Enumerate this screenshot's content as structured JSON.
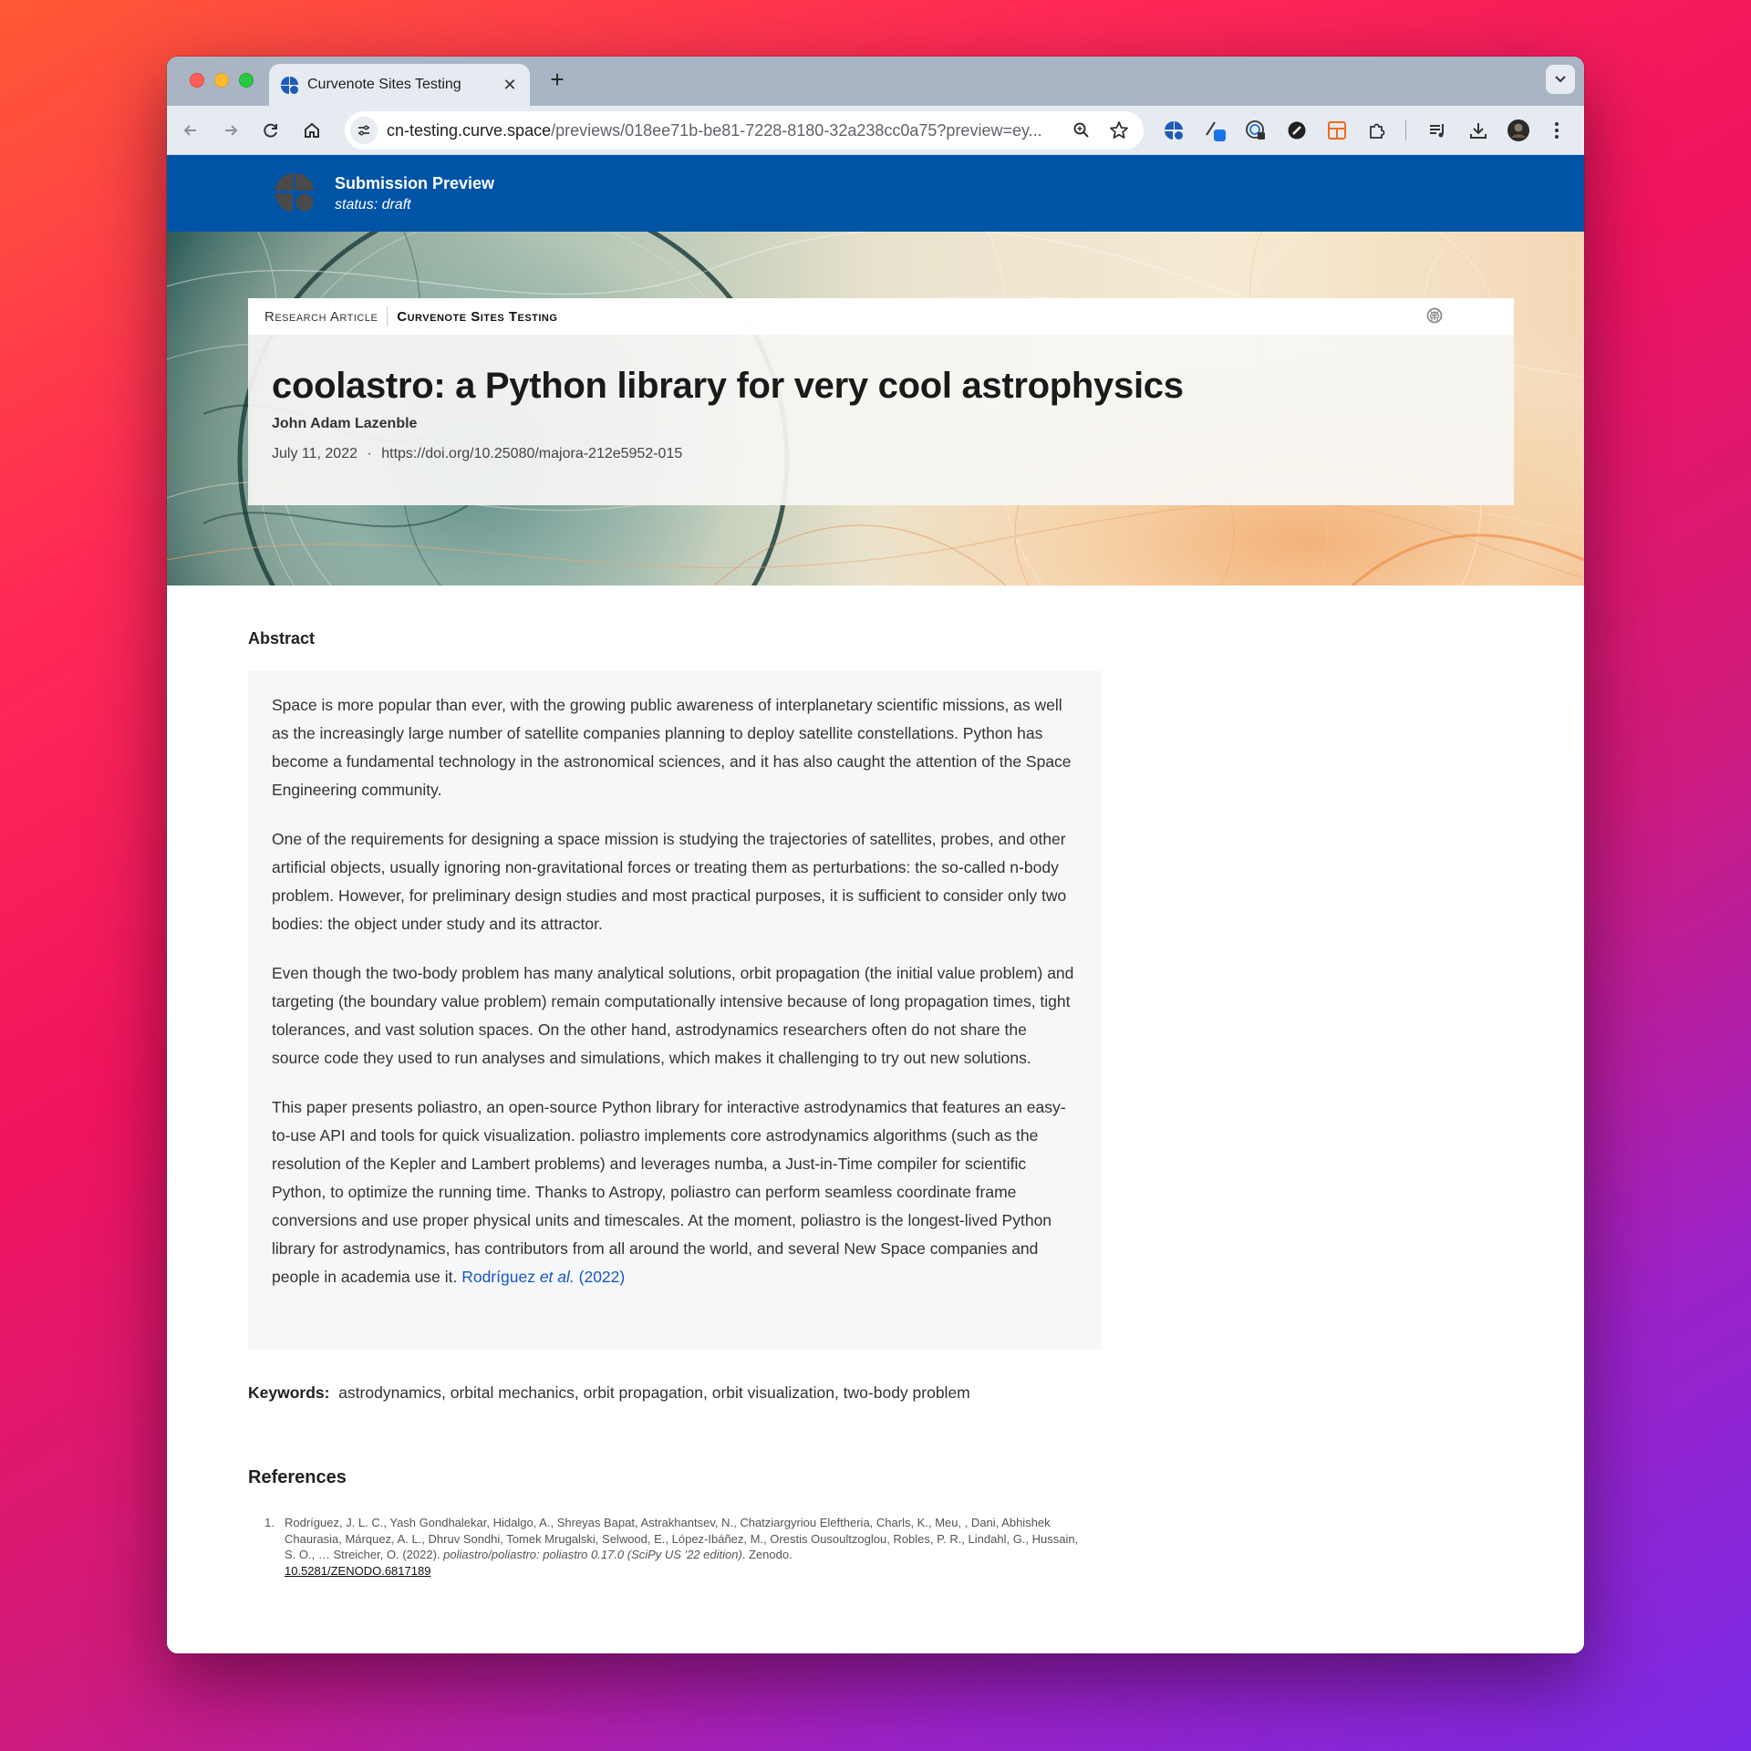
{
  "browser": {
    "tab_title": "Curvenote Sites Testing",
    "url_host": "cn-testing.curve.space",
    "url_path": "/previews/018ee71b-be81-7228-8180-32a238cc0a75?preview=ey..."
  },
  "banner": {
    "title": "Submission Preview",
    "status": "status: draft"
  },
  "article": {
    "kicker": "Research Article",
    "venue": "Curvenote Sites Testing",
    "title": "coolastro: a Python library for very cool astrophysics",
    "author": "John Adam Lazenble",
    "date": "July 11, 2022",
    "doi": "https://doi.org/10.25080/majora-212e5952-015"
  },
  "abstract": {
    "heading": "Abstract",
    "paragraphs": [
      "Space is more popular than ever, with the growing public awareness of interplanetary scientific missions, as well as the increasingly large number of satellite companies planning to deploy satellite constellations. Python has become a fundamental technology in the astronomical sciences, and it has also caught the attention of the Space Engineering community.",
      "One of the requirements for designing a space mission is studying the trajectories of satellites, probes, and other artificial objects, usually ignoring non-gravitational forces or treating them as perturbations: the so-called n-body problem. However, for preliminary design studies and most practical purposes, it is sufficient to consider only two bodies: the object under study and its attractor.",
      "Even though the two-body problem has many analytical solutions, orbit propagation (the initial value problem) and targeting (the boundary value problem) remain computationally intensive because of long propagation times, tight tolerances, and vast solution spaces. On the other hand, astrodynamics researchers often do not share the source code they used to run analyses and simulations, which makes it challenging to try out new solutions.",
      "This paper presents poliastro, an open-source Python library for interactive astrodynamics that features an easy-to-use API and tools for quick visualization. poliastro implements core astrodynamics algorithms (such as the resolution of the Kepler and Lambert problems) and leverages numba, a Just-in-Time compiler for scientific Python, to optimize the running time. Thanks to Astropy, poliastro can perform seamless coordinate frame conversions and use proper physical units and timescales. At the moment, poliastro is the longest-lived Python library for astrodynamics, has contributors from all around the world, and several New Space companies and people in academia use it."
    ],
    "cite_author": "Rodríguez ",
    "cite_etal": "et al.",
    "cite_year": " (2022)"
  },
  "keywords": {
    "label": "Keywords:",
    "values": "astrodynamics, orbital mechanics, orbit propagation, orbit visualization, two-body problem"
  },
  "references": {
    "heading": "References",
    "items": [
      {
        "num": "1.",
        "authors": "Rodríguez, J. L. C., Yash Gondhalekar, Hidalgo, A., Shreyas Bapat, Astrakhantsev, N., Chatziargyriou Eleftheria, Charls, K., Meu, , Dani, Abhishek Chaurasia, Márquez, A. L., Dhruv Sondhi, Tomek Mrugalski, Selwood, E., López-Ibáñez, M., Orestis Ousoultzoglou, Robles, P. R., Lindahl, G., Hussain, S. O., … Streicher, O. (2022). ",
        "title": "poliastro/poliastro: poliastro 0.17.0 (SciPy US '22 edition)",
        "publisher": ". Zenodo.",
        "doi": "10.5281/ZENODO.6817189"
      }
    ]
  },
  "colors": {
    "banner": "#0054a6",
    "link": "#1a56c4",
    "abstract_bg": "#f6f7f9"
  },
  "icons": [
    "back-icon",
    "forward-icon",
    "reload-icon",
    "home-icon",
    "site-info-icon",
    "zoom-icon",
    "bookmark-star-icon",
    "extensions-icon",
    "media-icon",
    "download-icon",
    "profile-avatar",
    "menu-icon",
    "cc-icon",
    "open-access-icon",
    "github-icon"
  ]
}
